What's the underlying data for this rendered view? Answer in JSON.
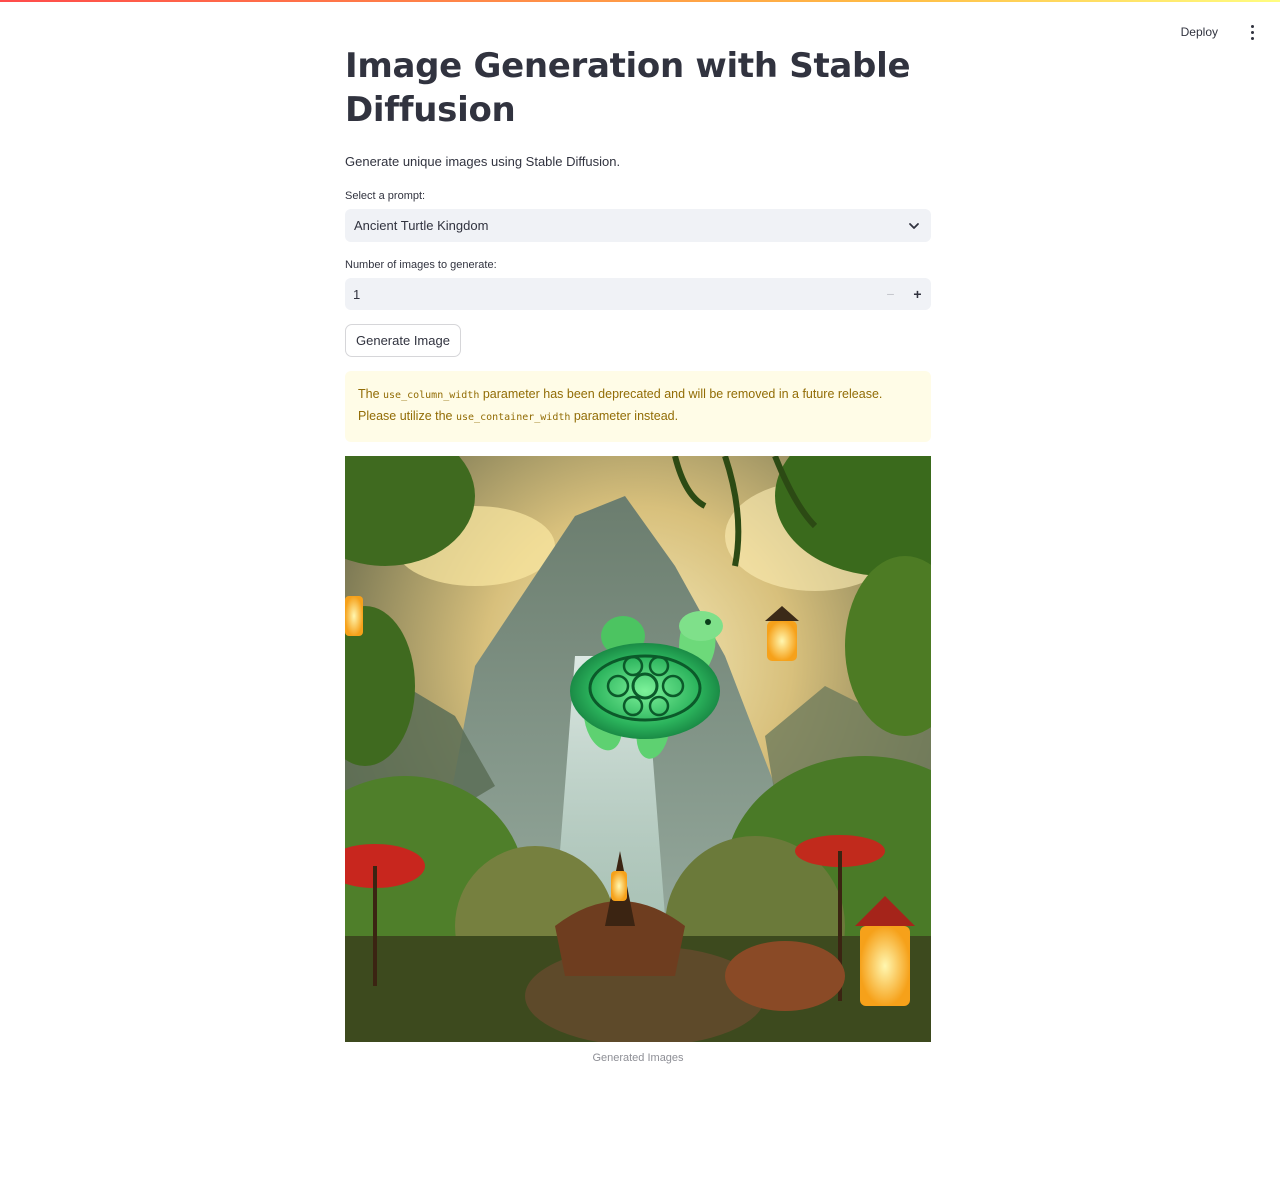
{
  "header": {
    "deploy_label": "Deploy",
    "menu_icon": "kebab-menu-icon"
  },
  "main": {
    "title": "Image Generation with Stable Diffusion",
    "subtitle": "Generate unique images using Stable Diffusion.",
    "prompt_select": {
      "label": "Select a prompt:",
      "value": "Ancient Turtle Kingdom",
      "icon": "chevron-down-icon"
    },
    "count_input": {
      "label": "Number of images to generate:",
      "value": "1",
      "minus": "−",
      "plus": "+"
    },
    "generate_button": "Generate Image",
    "warning": {
      "part1": "The ",
      "code1": "use_column_width",
      "part2": " parameter has been deprecated and will be removed in a future release. Please utilize the ",
      "code2": "use_container_width",
      "part3": " parameter instead."
    },
    "image": {
      "description": "turtle-fantasy-image",
      "caption": "Generated Images"
    }
  },
  "colors": {
    "accent": "#ff4b4b",
    "warning_bg": "#fffce7",
    "warning_text": "#926c05",
    "input_bg": "#f0f2f6"
  }
}
